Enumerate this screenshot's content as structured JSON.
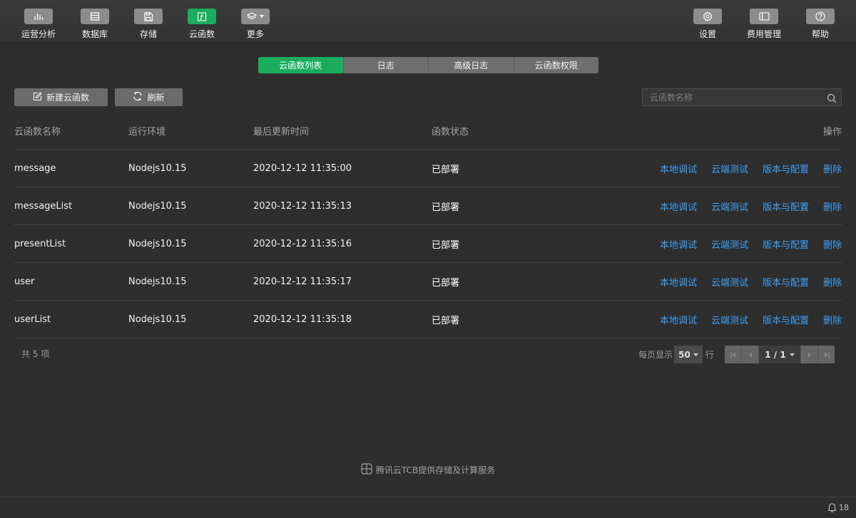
{
  "toolbar": {
    "left": [
      {
        "label": "运营分析",
        "icon": "bar-chart-icon"
      },
      {
        "label": "数据库",
        "icon": "database-icon"
      },
      {
        "label": "存储",
        "icon": "storage-icon"
      },
      {
        "label": "云函数",
        "icon": "function-icon",
        "active": true
      },
      {
        "label": "更多",
        "icon": "layers-icon"
      }
    ],
    "right": [
      {
        "label": "设置",
        "icon": "gear-icon"
      },
      {
        "label": "费用管理",
        "icon": "billing-icon"
      },
      {
        "label": "帮助",
        "icon": "help-icon"
      }
    ]
  },
  "tabs": [
    "云函数列表",
    "日志",
    "高级日志",
    "云函数权限"
  ],
  "active_tab": "云函数列表",
  "actions": {
    "new_label": "新建云函数",
    "refresh_label": "刷新"
  },
  "search": {
    "placeholder": "云函数名称"
  },
  "table": {
    "headers": {
      "name": "云函数名称",
      "env": "运行环境",
      "time": "最后更新时间",
      "status": "函数状态",
      "ops": "操作"
    },
    "ops_labels": [
      "本地调试",
      "云端测试",
      "版本与配置",
      "删除"
    ],
    "rows": [
      {
        "name": "message",
        "env": "Nodejs10.15",
        "time": "2020-12-12 11:35:00",
        "status": "已部署"
      },
      {
        "name": "messageList",
        "env": "Nodejs10.15",
        "time": "2020-12-12 11:35:13",
        "status": "已部署"
      },
      {
        "name": "presentList",
        "env": "Nodejs10.15",
        "time": "2020-12-12 11:35:16",
        "status": "已部署"
      },
      {
        "name": "user",
        "env": "Nodejs10.15",
        "time": "2020-12-12 11:35:17",
        "status": "已部署"
      },
      {
        "name": "userList",
        "env": "Nodejs10.15",
        "time": "2020-12-12 11:35:18",
        "status": "已部署"
      }
    ]
  },
  "footer": {
    "total": "共 5 项",
    "page_size_prefix": "每页显示",
    "page_size": "50",
    "page_size_suffix": "行",
    "page_indicator": "1 / 1"
  },
  "brand": {
    "text": "腾讯云TCB提供存储及计算服务"
  },
  "statusbar": {
    "notifications": "18"
  },
  "colors": {
    "accent": "#1aad5e",
    "link": "#3d9ff5",
    "background": "#2e2e2e"
  }
}
